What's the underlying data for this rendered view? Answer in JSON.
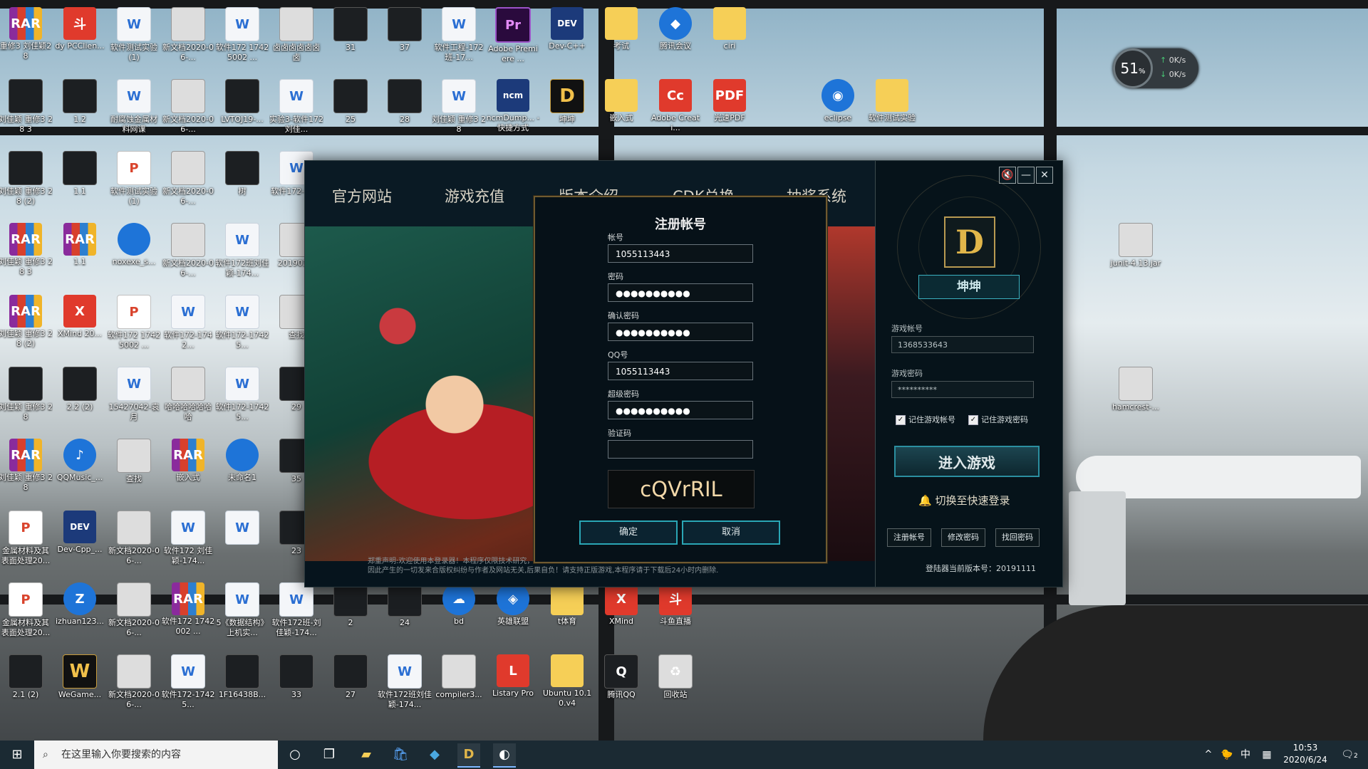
{
  "desktop": {
    "icons": [
      {
        "label": "重修3 刘佳颖28",
        "glyph": "RAR",
        "type": "rar"
      },
      {
        "label": "dy PCClien...",
        "glyph": "斗",
        "type": "red"
      },
      {
        "label": "软件测试实验(1)",
        "glyph": "W",
        "type": "doc"
      },
      {
        "label": "新文档2020-06-...",
        "glyph": "",
        "type": "img"
      },
      {
        "label": "软件172 17425002 ...",
        "glyph": "W",
        "type": "doc"
      },
      {
        "label": "卤卤卤卤卤卤卤",
        "glyph": "",
        "type": "img"
      },
      {
        "label": "31",
        "glyph": "",
        "type": "dark"
      },
      {
        "label": "37",
        "glyph": "",
        "type": "dark"
      },
      {
        "label": "软件工程-172班-17...",
        "glyph": "W",
        "type": "doc"
      },
      {
        "label": "Adobe Premiere ...",
        "glyph": "Pr",
        "type": "pr"
      },
      {
        "label": "Dev-C++",
        "glyph": "DEV",
        "type": "dev"
      },
      {
        "label": "考试",
        "glyph": "",
        "type": "folder"
      },
      {
        "label": "腾讯会议",
        "glyph": "◆",
        "type": "blue"
      },
      {
        "label": "ciri",
        "glyph": "",
        "type": "folder"
      },
      {
        "label": "刘佳颖 重修3 28 3",
        "glyph": "",
        "type": "dark"
      },
      {
        "label": "1.2",
        "glyph": "",
        "type": "dark"
      },
      {
        "label": "耐腐蚀金属材料网课",
        "glyph": "W",
        "type": "doc"
      },
      {
        "label": "新文档2020-06-...",
        "glyph": "",
        "type": "img"
      },
      {
        "label": "LVTOJ19-...",
        "glyph": "",
        "type": "dark"
      },
      {
        "label": "实验3-软件172刘佳...",
        "glyph": "W",
        "type": "doc"
      },
      {
        "label": "25",
        "glyph": "",
        "type": "dark"
      },
      {
        "label": "28",
        "glyph": "",
        "type": "dark"
      },
      {
        "label": "刘佳颖 重修3 28",
        "glyph": "W",
        "type": "doc"
      },
      {
        "label": "ncmDump... - 快捷方式",
        "glyph": "ncm",
        "type": "dev"
      },
      {
        "label": "坤坤",
        "glyph": "D",
        "type": "D"
      },
      {
        "label": "嵌入式",
        "glyph": "",
        "type": "folder"
      },
      {
        "label": "Adobe Creati...",
        "glyph": "Cc",
        "type": "red"
      },
      {
        "label": "光速PDF",
        "glyph": "PDF",
        "type": "red"
      },
      {
        "label": "eclipse",
        "glyph": "◉",
        "type": "blue"
      },
      {
        "label": "软件测试实验",
        "glyph": "",
        "type": "folder"
      },
      {
        "label": "刘佳颖 重修3 28 (2)",
        "glyph": "",
        "type": "dark"
      },
      {
        "label": "1.1",
        "glyph": "",
        "type": "dark"
      },
      {
        "label": "软件测试实验(1)",
        "glyph": "P",
        "type": "pdf"
      },
      {
        "label": "新文档2020-06-...",
        "glyph": "",
        "type": "img"
      },
      {
        "label": "树",
        "glyph": "",
        "type": "dark"
      },
      {
        "label": "软件172-17...",
        "glyph": "W",
        "type": "doc"
      },
      {
        "label": "刘佳颖 重修3 28 3",
        "glyph": "RAR",
        "type": "rar"
      },
      {
        "label": "1.1",
        "glyph": "RAR",
        "type": "rar"
      },
      {
        "label": "noxexe_s...",
        "glyph": "",
        "type": "blue"
      },
      {
        "label": "新文档2020-06-...",
        "glyph": "",
        "type": "img"
      },
      {
        "label": "软件172班刘佳颖-174...",
        "glyph": "W",
        "type": "doc"
      },
      {
        "label": "201903...",
        "glyph": "",
        "type": "img"
      },
      {
        "label": "刘佳颖 重修3 28 (2)",
        "glyph": "RAR",
        "type": "rar"
      },
      {
        "label": "XMind 20...",
        "glyph": "X",
        "type": "red"
      },
      {
        "label": "软件172 17425002 ...",
        "glyph": "P",
        "type": "pdf"
      },
      {
        "label": "软件172-1742...",
        "glyph": "W",
        "type": "doc"
      },
      {
        "label": "软件172-17425...",
        "glyph": "W",
        "type": "doc"
      },
      {
        "label": "查找",
        "glyph": "",
        "type": "img"
      },
      {
        "label": "刘佳颖 重修3 28",
        "glyph": "",
        "type": "dark"
      },
      {
        "label": "2.2 (2)",
        "glyph": "",
        "type": "dark"
      },
      {
        "label": "15427042-袁月",
        "glyph": "W",
        "type": "doc"
      },
      {
        "label": "哈哈哈哈哈哈哈",
        "glyph": "",
        "type": "img"
      },
      {
        "label": "软件172-17425...",
        "glyph": "W",
        "type": "doc"
      },
      {
        "label": "29",
        "glyph": "",
        "type": "dark"
      },
      {
        "label": "刘佳颖 重修3 28",
        "glyph": "RAR",
        "type": "rar"
      },
      {
        "label": "QQMusic_...",
        "glyph": "♪",
        "type": "blue"
      },
      {
        "label": "查找",
        "glyph": "",
        "type": "img"
      },
      {
        "label": "嵌入式",
        "glyph": "RAR",
        "type": "rar"
      },
      {
        "label": "未命名1",
        "glyph": "",
        "type": "blue"
      },
      {
        "label": "35",
        "glyph": "",
        "type": "dark"
      },
      {
        "label": "金属材料及其表面处理20...",
        "glyph": "P",
        "type": "pdf"
      },
      {
        "label": "Dev-Cpp_...",
        "glyph": "DEV",
        "type": "dev"
      },
      {
        "label": "新文档2020-06-...",
        "glyph": "",
        "type": "img"
      },
      {
        "label": "软件172 刘佳颖-174...",
        "glyph": "W",
        "type": "doc"
      },
      {
        "label": "",
        "glyph": "W",
        "type": "doc"
      },
      {
        "label": "23",
        "glyph": "",
        "type": "dark"
      },
      {
        "label": "金属材料及其表面处理20...",
        "glyph": "P",
        "type": "pdf"
      },
      {
        "label": "izhuan123...",
        "glyph": "Z",
        "type": "blue"
      },
      {
        "label": "新文档2020-06-...",
        "glyph": "",
        "type": "img"
      },
      {
        "label": "软件172 1742002 ...",
        "glyph": "RAR",
        "type": "rar"
      },
      {
        "label": "5《数据结构》上机实...",
        "glyph": "W",
        "type": "doc"
      },
      {
        "label": "软件172班-刘佳颖-174...",
        "glyph": "W",
        "type": "doc"
      },
      {
        "label": "2",
        "glyph": "",
        "type": "dark"
      },
      {
        "label": "24",
        "glyph": "",
        "type": "dark"
      },
      {
        "label": "bd",
        "glyph": "☁",
        "type": "blue"
      },
      {
        "label": "英雄联盟",
        "glyph": "◈",
        "type": "blue"
      },
      {
        "label": "t体育",
        "glyph": "",
        "type": "folder"
      },
      {
        "label": "XMind",
        "glyph": "X",
        "type": "red"
      },
      {
        "label": "斗鱼直播",
        "glyph": "斗",
        "type": "red"
      },
      {
        "label": "2.1 (2)",
        "glyph": "",
        "type": "dark"
      },
      {
        "label": "WeGame...",
        "glyph": "W",
        "type": "D"
      },
      {
        "label": "新文档2020-06-...",
        "glyph": "",
        "type": "img"
      },
      {
        "label": "软件172-17425...",
        "glyph": "W",
        "type": "doc"
      },
      {
        "label": "1F16438B...",
        "glyph": "",
        "type": "dark"
      },
      {
        "label": "33",
        "glyph": "",
        "type": "dark"
      },
      {
        "label": "27",
        "glyph": "",
        "type": "dark"
      },
      {
        "label": "软件172班刘佳颖-174...",
        "glyph": "W",
        "type": "doc"
      },
      {
        "label": "compiler3...",
        "glyph": "",
        "type": "img"
      },
      {
        "label": "Listary Pro",
        "glyph": "L",
        "type": "red"
      },
      {
        "label": "Ubuntu 10.10.v4",
        "glyph": "",
        "type": "folder"
      },
      {
        "label": "腾讯QQ",
        "glyph": "Q",
        "type": "dark"
      },
      {
        "label": "回收站",
        "glyph": "♻",
        "type": "img"
      },
      {
        "label": "junit-4.13.jar",
        "glyph": "",
        "type": "img"
      },
      {
        "label": "hamcrest-...",
        "glyph": "",
        "type": "img"
      }
    ]
  },
  "speed_widget": {
    "percent": "51",
    "percent_unit": "%",
    "up": "0K/s",
    "down": "0K/s"
  },
  "launcher": {
    "nav_tabs": [
      "官方网站",
      "游戏充值",
      "版本介绍",
      "CDK兑换",
      "抽奖系统"
    ],
    "disclaimer_line1": "郑重声明:欢迎使用本登录器！本程序仅限技术研究，请勿用于非法用途，",
    "disclaimer_line2": "因此产生的一切发来合版权纠纷与作者及网站无关,后果自负！请支持正版游戏,本程序请于下载后24小时内删除.",
    "side": {
      "mute_icon": "🔇",
      "minimize": "—",
      "close": "✕",
      "logo_letter": "D",
      "username": "坤坤",
      "account_label": "游戏帐号",
      "account_value": "1368533643",
      "password_label": "游戏密码",
      "password_value": "**********",
      "remember_account": "记住游戏帐号",
      "remember_password": "记住游戏密码",
      "enter_button": "进入游戏",
      "quick_login": "切换至快速登录",
      "register_button": "注册帐号",
      "change_pw_button": "修改密码",
      "recover_pw_button": "找回密码",
      "version": "登陆器当前版本号：20191111"
    }
  },
  "register_dialog": {
    "title": "注册帐号",
    "account_label": "帐号",
    "account_value": "1055113443",
    "password_label": "密码",
    "password_value": "●●●●●●●●●●",
    "confirm_label": "确认密码",
    "confirm_value": "●●●●●●●●●●",
    "qq_label": "QQ号",
    "qq_value": "1055113443",
    "super_pw_label": "超级密码",
    "super_pw_value": "●●●●●●●●●●",
    "captcha_label": "验证码",
    "captcha_value": "",
    "captcha_text": "cQVrRIL",
    "ok_button": "确定",
    "cancel_button": "取消"
  },
  "taskbar": {
    "search_placeholder": "在这里输入你要搜索的内容",
    "ime": "中",
    "time": "10:53",
    "date": "2020/6/24",
    "notification_count": "2"
  }
}
